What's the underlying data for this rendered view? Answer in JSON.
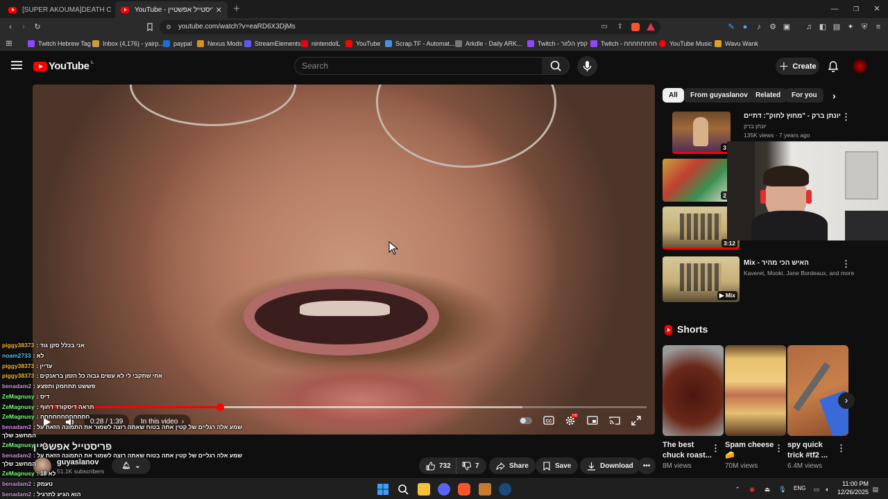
{
  "browser": {
    "tabs": [
      {
        "label": "[SUPER AKOUMA]DEATH COMBO C..."
      },
      {
        "label": "YouTube - פריסטייל אפשטיין"
      }
    ],
    "url": "youtube.com/watch?v=eaRD6X3DjMs",
    "bookmarks": [
      {
        "label": "Twitch Hebrew Tag",
        "color": "#9146ff"
      },
      {
        "label": "Inbox (4,176) - yairp...",
        "color": "#c94"
      },
      {
        "label": "paypal",
        "color": "#1a6fcf"
      },
      {
        "label": "Nexus Mods",
        "color": "#d98f2b"
      },
      {
        "label": "StreamElements",
        "color": "#5b5bf0"
      },
      {
        "label": "nintendolL",
        "color": "#e60012"
      },
      {
        "label": "YouTube",
        "color": "#f00"
      },
      {
        "label": "Scrap.TF - Automat...",
        "color": "#4a90e2"
      },
      {
        "label": "Arkdle - Daily ARK...",
        "color": "#777"
      },
      {
        "label": "Twitch - קפץ הלזור",
        "color": "#9146ff"
      },
      {
        "label": "Twitch - חחחחחחחח",
        "color": "#9146ff"
      },
      {
        "label": "YouTube Music",
        "color": "#f00"
      },
      {
        "label": "Wavu Wank",
        "color": "#e0a020"
      }
    ]
  },
  "header": {
    "logo": "YouTube",
    "country": "IL",
    "search_placeholder": "Search",
    "create_label": "Create"
  },
  "player": {
    "current_time": "0:28 / 1:39",
    "chapters_label": "In this video",
    "progress_fraction": 0.295,
    "buffer_fraction": 0.795
  },
  "chips": [
    "All",
    "From guyaslanov",
    "Related",
    "For you"
  ],
  "recommendations": [
    {
      "title": "יונתן ברק - \"מחוץ לחוק\": דתיים",
      "channel": "יונתן ברק",
      "meta": "135K views · 7 years ago",
      "duration": "3"
    },
    {
      "title": "",
      "channel": "",
      "meta": "",
      "duration": "2"
    },
    {
      "title": "",
      "channel": "",
      "meta": "",
      "duration": "3:12"
    },
    {
      "title": "Mix - האיש הכי מהיר",
      "channel": "Kaveret, Mooki, Jane Bordeaux, and more",
      "meta": "",
      "duration": "Mix"
    }
  ],
  "shorts": {
    "heading": "Shorts",
    "items": [
      {
        "title": "The best chuck roast...",
        "views": "8M views"
      },
      {
        "title": "Spam cheese 🧀",
        "views": "70M views"
      },
      {
        "title": "spy quick trick #tf2 ...",
        "views": "6.4M views"
      }
    ]
  },
  "video": {
    "title": "פריסטייל אפשטיין",
    "channel": "guyaslanov",
    "subscribers": "51.1K subscribers",
    "likes": "732",
    "dislikes": "7",
    "share_label": "Share",
    "save_label": "Save",
    "download_label": "Download"
  },
  "chat": [
    {
      "user": "piggy38373",
      "color": "#f7b733",
      "msg": ": אני בכלל סקן גוד"
    },
    {
      "user": "noam2733",
      "color": "#4fc3f7",
      "msg": ": לא"
    },
    {
      "user": "piggy38373",
      "color": "#f7b733",
      "msg": ": עדיין"
    },
    {
      "user": "piggy38373",
      "color": "#f7b733",
      "msg": ": אחי שתקבי לי לא עשים גבוה כל הזמן בראנקים"
    },
    {
      "user": "benadam2",
      "color": "#ce93d8",
      "msg": ": פששט תתחמק ותפצע"
    },
    {
      "user": "ZeMagnusy",
      "color": "#7cff7c",
      "msg": ": דיס"
    },
    {
      "user": "ZeMagnusy",
      "color": "#7cff7c",
      "msg": ": תראה דיסקורד דחוף"
    },
    {
      "user": "ZeMagnusy",
      "color": "#7cff7c",
      "msg": ": חחחחחחחחחחחח"
    },
    {
      "user": "benadam2",
      "color": "#ce93d8",
      "msg": ": שמע אלה רגליים של קטין אתה בטוח שאתה רוצה לשמור את התמונה הזאת על"
    },
    {
      "user": "",
      "color": "#fff",
      "msg": "המחשב שלך"
    },
    {
      "user": "ZeMagnusy",
      "color": "#7cff7c",
      "msg": ": לא"
    },
    {
      "user": "benadam2",
      "color": "#ce93d8",
      "msg": ": שמע אלה רגליים של קטין אתה בטוח שאתה רוצה לשמור את התמונה הזאת על"
    },
    {
      "user": "",
      "color": "#fff",
      "msg": "המחשב שלך"
    },
    {
      "user": "ZeMagnusy",
      "color": "#7cff7c",
      "msg": ": 18 לא"
    },
    {
      "user": "benadam2",
      "color": "#ce93d8",
      "msg": ": טעמק"
    },
    {
      "user": "benadam2",
      "color": "#ce93d8",
      "msg": ": הוא הגיע לתרגיל"
    }
  ],
  "taskbar": {
    "language": "ENG",
    "time": "11:00 PM",
    "date": "12/26/2025"
  }
}
